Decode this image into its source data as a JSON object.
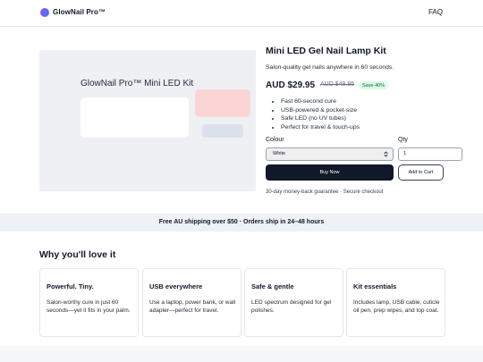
{
  "header": {
    "brand": "GlowNail Pro™",
    "faq_link": "FAQ"
  },
  "hero_image": {
    "label": "GlowNail Pro™ Mini LED Kit"
  },
  "product": {
    "title": "Mini LED Gel Nail Lamp Kit",
    "subtitle": "Salon-quality gel nails anywhere in 60 seconds.",
    "price": "AUD $29.95",
    "compare_price": "AUD $49.95",
    "save_badge": "Save 40%",
    "features": [
      "Fast 60-second cure",
      "USB-powered & pocket-size",
      "Safe LED (no UV tubes)",
      "Perfect for travel & touch-ups"
    ],
    "colour_label": "Colour",
    "colour_value": "White",
    "qty_label": "Qty",
    "qty_value": "1",
    "buy_now": "Buy Now",
    "add_to_cart": "Add to Cart",
    "guarantee": "30-day money-back guarantee · Secure checkout"
  },
  "banner": {
    "text": "Free AU shipping over $50 · Orders ship in 24–48 hours"
  },
  "why": {
    "title": "Why you'll love it",
    "cards": [
      {
        "title": "Powerful. Tiny.",
        "body": "Salon-worthy cure in just 60 seconds—yet it fits in your palm."
      },
      {
        "title": "USB everywhere",
        "body": "Use a laptop, power bank, or wall adapter—perfect for travel."
      },
      {
        "title": "Safe & gentle",
        "body": "LED spectrum designed for gel polishes."
      },
      {
        "title": "Kit essentials",
        "body": "Includes lamp, USB cable, cuticle oil pen, prep wipes, and top coat."
      }
    ]
  },
  "colors": {
    "primary": "#111827",
    "save_badge_bg": "#dcfce7",
    "save_badge_text": "#166534",
    "banner_bg": "#eef1f6",
    "hero_bg": "#eef0f4",
    "hero_accent_pink": "#fbd5d5"
  },
  "icons": {
    "logo": "gradient-circle-logo-icon",
    "select": "chevron-updown-icon"
  }
}
